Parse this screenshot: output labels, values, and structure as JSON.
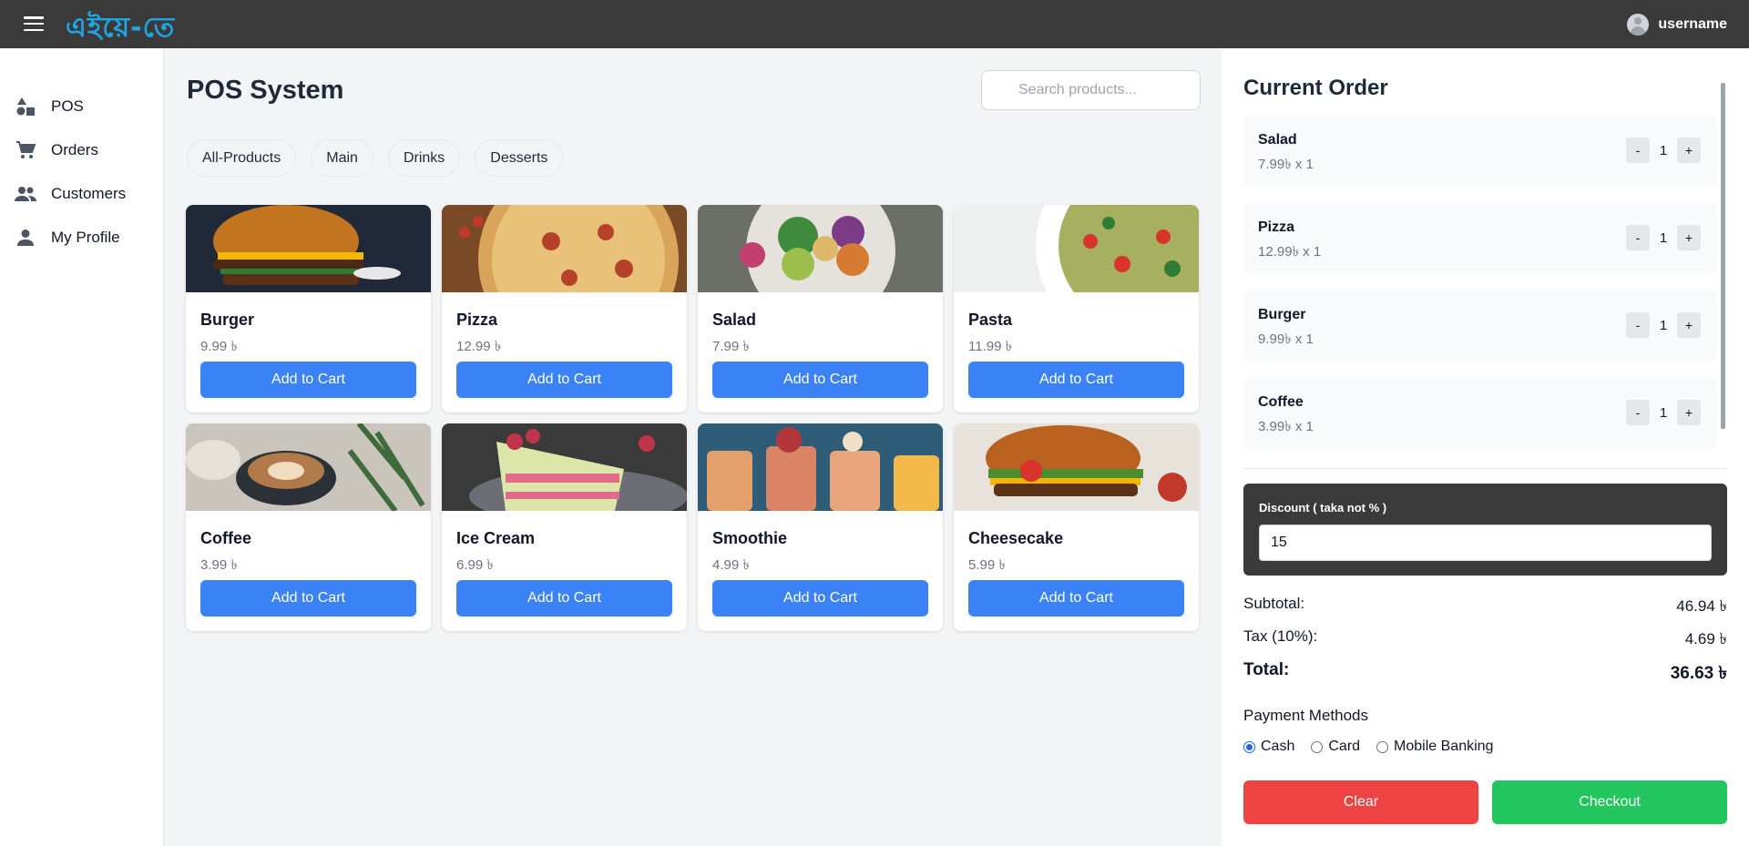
{
  "header": {
    "logo_text": "এইয়ে-তে",
    "username": "username"
  },
  "sidebar": {
    "items": [
      {
        "label": "POS",
        "icon": "shapes-icon"
      },
      {
        "label": "Orders",
        "icon": "cart-icon"
      },
      {
        "label": "Customers",
        "icon": "people-icon"
      },
      {
        "label": "My Profile",
        "icon": "person-icon"
      }
    ]
  },
  "main": {
    "title": "POS System",
    "search_placeholder": "Search products...",
    "categories": [
      "All-Products",
      "Main",
      "Drinks",
      "Desserts"
    ],
    "add_label": "Add to Cart",
    "products": [
      {
        "name": "Burger",
        "price": "9.99 ৳"
      },
      {
        "name": "Pizza",
        "price": "12.99 ৳"
      },
      {
        "name": "Salad",
        "price": "7.99 ৳"
      },
      {
        "name": "Pasta",
        "price": "11.99 ৳"
      },
      {
        "name": "Coffee",
        "price": "3.99 ৳"
      },
      {
        "name": "Ice Cream",
        "price": "6.99 ৳"
      },
      {
        "name": "Smoothie",
        "price": "4.99 ৳"
      },
      {
        "name": "Cheesecake",
        "price": "5.99 ৳"
      }
    ]
  },
  "order": {
    "title": "Current Order",
    "items": [
      {
        "name": "Salad",
        "meta": "7.99৳ x 1",
        "qty": "1"
      },
      {
        "name": "Pizza",
        "meta": "12.99৳ x 1",
        "qty": "1"
      },
      {
        "name": "Burger",
        "meta": "9.99৳ x 1",
        "qty": "1"
      },
      {
        "name": "Coffee",
        "meta": "3.99৳ x 1",
        "qty": "1"
      }
    ],
    "minus": "-",
    "plus": "+",
    "discount_label": "Discount ( taka not % )",
    "discount_value": "15",
    "subtotal_label": "Subtotal:",
    "subtotal_value": "46.94 ৳",
    "tax_label": "Tax (10%):",
    "tax_value": "4.69 ৳",
    "total_label": "Total:",
    "total_value": "36.63 ৳",
    "payment_title": "Payment Methods",
    "payment_methods": [
      "Cash",
      "Card",
      "Mobile Banking"
    ],
    "payment_selected": "Cash",
    "clear_label": "Clear",
    "checkout_label": "Checkout"
  },
  "colors": {
    "accent": "#3b82f6",
    "topbar": "#3a3a3a",
    "clear": "#ef4444",
    "checkout": "#22c55e",
    "logo": "#1ea7e6"
  }
}
